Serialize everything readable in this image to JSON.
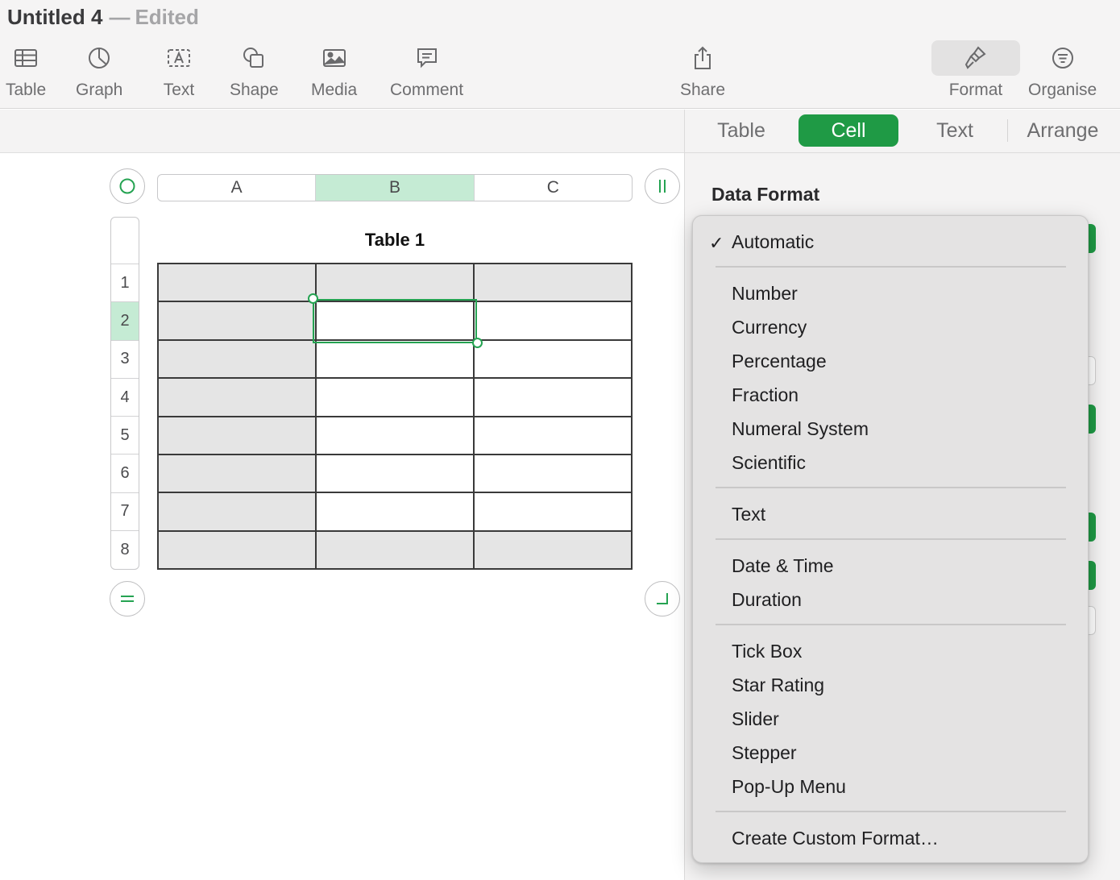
{
  "window": {
    "title": "Untitled 4",
    "separator": "—",
    "status": "Edited"
  },
  "toolbar": {
    "items": [
      {
        "label": "Table",
        "icon": "table-icon"
      },
      {
        "label": "Graph",
        "icon": "graph-icon"
      },
      {
        "label": "Text",
        "icon": "text-box-icon"
      },
      {
        "label": "Shape",
        "icon": "shape-icon"
      },
      {
        "label": "Media",
        "icon": "media-icon"
      },
      {
        "label": "Comment",
        "icon": "comment-icon"
      },
      {
        "label": "Share",
        "icon": "share-icon"
      },
      {
        "label": "Format",
        "icon": "paintbrush-icon",
        "active": true
      },
      {
        "label": "Organise",
        "icon": "organise-icon"
      }
    ]
  },
  "inspector": {
    "tabs": [
      {
        "label": "Table",
        "active": false
      },
      {
        "label": "Cell",
        "active": true
      },
      {
        "label": "Text",
        "active": false
      },
      {
        "label": "Arrange",
        "active": false
      }
    ],
    "section_title": "Data Format",
    "accent_color": "#1f9a45"
  },
  "spreadsheet": {
    "table_title": "Table 1",
    "columns": [
      "A",
      "B",
      "C"
    ],
    "selected_column": "B",
    "rows": [
      "1",
      "2",
      "3",
      "4",
      "5",
      "6",
      "7",
      "8"
    ],
    "selected_row": "2",
    "selected_cell": "B2",
    "selection_color": "#25a352"
  },
  "data_format_menu": {
    "selected": "Automatic",
    "check_glyph": "✓",
    "groups": [
      [
        "Automatic"
      ],
      [
        "Number",
        "Currency",
        "Percentage",
        "Fraction",
        "Numeral System",
        "Scientific"
      ],
      [
        "Text"
      ],
      [
        "Date & Time",
        "Duration"
      ],
      [
        "Tick Box",
        "Star Rating",
        "Slider",
        "Stepper",
        "Pop-Up Menu"
      ],
      [
        "Create Custom Format…"
      ]
    ],
    "items": {
      "automatic": "Automatic",
      "number": "Number",
      "currency": "Currency",
      "percentage": "Percentage",
      "fraction": "Fraction",
      "numeral_system": "Numeral System",
      "scientific": "Scientific",
      "text": "Text",
      "date_time": "Date & Time",
      "duration": "Duration",
      "tick_box": "Tick Box",
      "star_rating": "Star Rating",
      "slider": "Slider",
      "stepper": "Stepper",
      "popup_menu": "Pop-Up Menu",
      "custom": "Create Custom Format…"
    }
  }
}
